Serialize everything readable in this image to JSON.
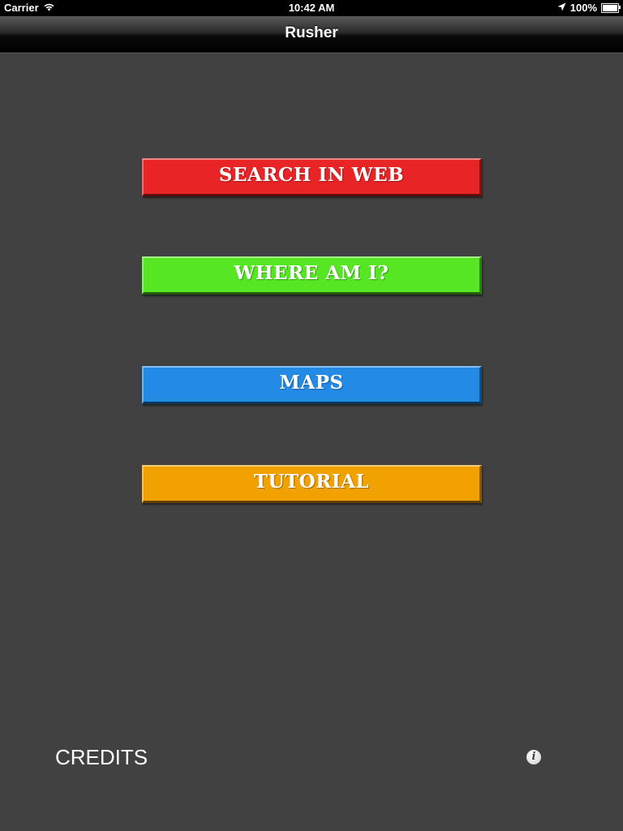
{
  "status_bar": {
    "carrier": "Carrier",
    "time": "10:42 AM",
    "battery": "100%",
    "icons": [
      "wifi-icon",
      "location-arrow-icon",
      "battery-icon"
    ]
  },
  "nav_bar": {
    "title": "Rusher"
  },
  "menu": {
    "items": [
      {
        "label": "SEARCH IN WEB",
        "color": "#e82426"
      },
      {
        "label": "WHERE AM I?",
        "color": "#56e624"
      },
      {
        "label": "MAPS",
        "color": "#238ae6"
      },
      {
        "label": "TUTORIAL",
        "color": "#f1a100"
      }
    ]
  },
  "footer": {
    "credits_label": "CREDITS",
    "info_icon": "info-icon"
  },
  "colors": {
    "background": "#414141",
    "status_bar": "#000000"
  }
}
